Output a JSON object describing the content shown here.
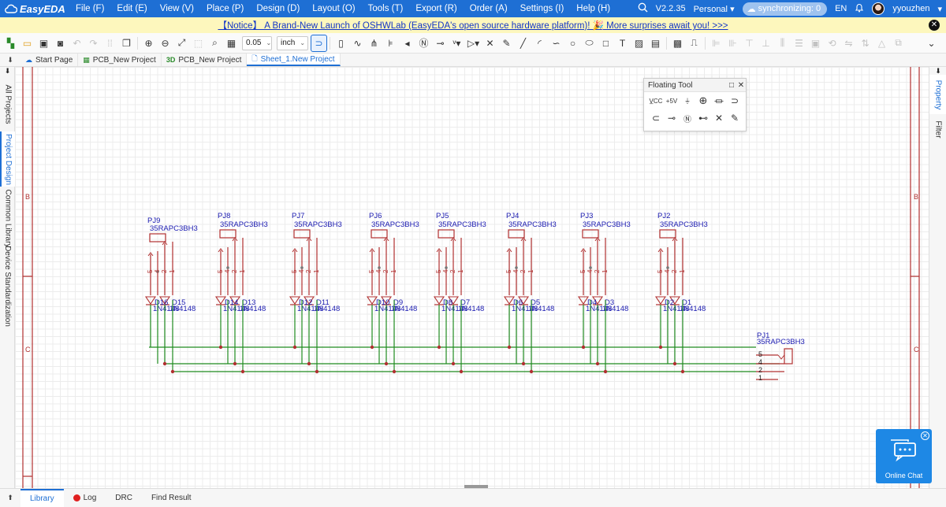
{
  "app": {
    "name": "EasyEDA",
    "version": "V2.2.35"
  },
  "menu": [
    "File (F)",
    "Edit (E)",
    "View (V)",
    "Place (P)",
    "Design (D)",
    "Layout (O)",
    "Tools (T)",
    "Export (R)",
    "Order (A)",
    "Settings (I)",
    "Help (H)"
  ],
  "header": {
    "workspace": "Personal",
    "sync_label": "synchronizing: 0",
    "language": "EN",
    "username": "yyouzhen"
  },
  "notice": {
    "text": "【Notice】 A Brand-New Launch of OSHWLab (EasyEDA's open source hardware platform)! 🎉 More surprises await you! >>>"
  },
  "toolbar": {
    "zoom_value": "0.05",
    "unit": "inch"
  },
  "tabs": [
    {
      "label": "Start Page",
      "icon": "cloud-icon"
    },
    {
      "label": "PCB_New Project",
      "icon": "pcb-icon"
    },
    {
      "label": "PCB_New Project",
      "icon": "3d-icon",
      "prefix": "3D"
    },
    {
      "label": "Sheet_1.New Project",
      "icon": "sheet-icon"
    }
  ],
  "left_panel": [
    "All Projects",
    "Project Design",
    "Common Library",
    "Device Standardization"
  ],
  "right_panel": [
    "Property",
    "Filter"
  ],
  "floating_tool": {
    "title": "Floating Tool"
  },
  "schematic": {
    "frame_labels": [
      "B",
      "C"
    ],
    "connectors": [
      {
        "ref": "PJ9",
        "value": "35RAPC3BH3"
      },
      {
        "ref": "PJ8",
        "value": "35RAPC3BH3"
      },
      {
        "ref": "PJ7",
        "value": "35RAPC3BH3"
      },
      {
        "ref": "PJ6",
        "value": "35RAPC3BH3"
      },
      {
        "ref": "PJ5",
        "value": "35RAPC3BH3"
      },
      {
        "ref": "PJ4",
        "value": "35RAPC3BH3"
      },
      {
        "ref": "PJ3",
        "value": "35RAPC3BH3"
      },
      {
        "ref": "PJ2",
        "value": "35RAPC3BH3"
      }
    ],
    "diodes": [
      {
        "left": "D16",
        "right": "D15"
      },
      {
        "left": "D14",
        "right": "D13"
      },
      {
        "left": "D12",
        "right": "D11"
      },
      {
        "left": "D10",
        "right": "D9"
      },
      {
        "left": "D8",
        "right": "D7"
      },
      {
        "left": "D6",
        "right": "D5"
      },
      {
        "left": "D4",
        "right": "D3"
      },
      {
        "left": "D2",
        "right": "D1"
      }
    ],
    "diode_value": "1N4148",
    "pin_numbers": [
      "5",
      "4",
      "2",
      "1"
    ],
    "main_connector": {
      "ref": "PJ1",
      "value": "35RAPC3BH3"
    }
  },
  "chat": {
    "label": "Online Chat"
  },
  "bottom_tabs": [
    "Library",
    "Log",
    "DRC",
    "Find Result"
  ],
  "colors": {
    "accent": "#1e6fd4",
    "wire": "#1f8a1f",
    "part": "#b03030",
    "label": "#1a1ab0",
    "notice_bg": "#fdf7bd"
  }
}
